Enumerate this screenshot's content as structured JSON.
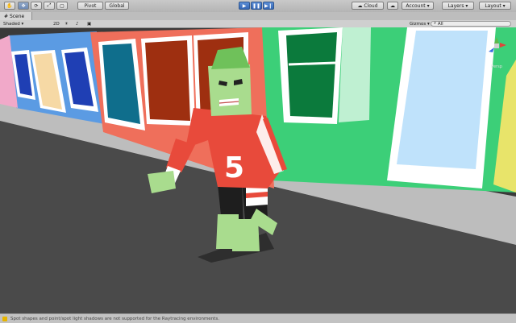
{
  "toolbar": {
    "tools": [
      "hand-tool",
      "move-tool",
      "rotate-tool",
      "scale-tool",
      "rect-tool"
    ],
    "pivot_label": "Pivot",
    "global_label": "Global",
    "cloud_label": "Cloud",
    "account_label": "Account",
    "layers_label": "Layers",
    "layout_label": "Layout"
  },
  "tab": {
    "scene_label": "Scene"
  },
  "scenebar": {
    "shading_label": "Shaded",
    "mode_2d_label": "2D",
    "gizmos_label": "Gizmos",
    "search_label": "All"
  },
  "gizmo": {
    "view_label": "Persp"
  },
  "status": {
    "message": "Spot shapes and point/spot light shadows are not supported for the Raytracing environments."
  },
  "colors": {
    "accent": "#3567b5",
    "street": "#4a4a4a",
    "sidewalk": "#bdbdbd",
    "house_blue": "#5b9be3",
    "house_coral": "#ef6f5b",
    "house_green": "#3ccf78",
    "shirt": "#e84a3b",
    "skin": "#a9dc8e"
  }
}
